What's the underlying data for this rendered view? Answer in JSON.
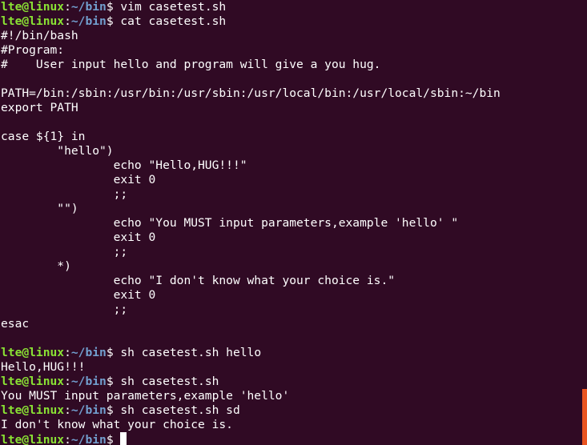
{
  "theme": {
    "background": "#300a24",
    "text": "#ffffff",
    "prompt_user": "#8ae234",
    "prompt_path": "#729fcf",
    "scrollbar_thumb": "#e95420"
  },
  "prompt": {
    "user": "lte@linux",
    "sep": ":",
    "path": "~/bin",
    "symbol": "$ "
  },
  "lines": [
    {
      "type": "prompt",
      "cmd": "vim casetest.sh"
    },
    {
      "type": "prompt",
      "cmd": "cat casetest.sh"
    },
    {
      "type": "output",
      "text": "#!/bin/bash"
    },
    {
      "type": "output",
      "text": "#Program:"
    },
    {
      "type": "output",
      "text": "#    User input hello and program will give a you hug."
    },
    {
      "type": "output",
      "text": ""
    },
    {
      "type": "output",
      "text": "PATH=/bin:/sbin:/usr/bin:/usr/sbin:/usr/local/bin:/usr/local/sbin:~/bin"
    },
    {
      "type": "output",
      "text": "export PATH"
    },
    {
      "type": "output",
      "text": ""
    },
    {
      "type": "output",
      "text": "case ${1} in"
    },
    {
      "type": "output",
      "text": "        \"hello\")"
    },
    {
      "type": "output",
      "text": "                echo \"Hello,HUG!!!\""
    },
    {
      "type": "output",
      "text": "                exit 0"
    },
    {
      "type": "output",
      "text": "                ;;"
    },
    {
      "type": "output",
      "text": "        \"\")"
    },
    {
      "type": "output",
      "text": "                echo \"You MUST input parameters,example 'hello' \""
    },
    {
      "type": "output",
      "text": "                exit 0"
    },
    {
      "type": "output",
      "text": "                ;;"
    },
    {
      "type": "output",
      "text": "        *)"
    },
    {
      "type": "output",
      "text": "                echo \"I don't know what your choice is.\""
    },
    {
      "type": "output",
      "text": "                exit 0"
    },
    {
      "type": "output",
      "text": "                ;;"
    },
    {
      "type": "output",
      "text": "esac"
    },
    {
      "type": "output",
      "text": ""
    },
    {
      "type": "prompt",
      "cmd": "sh casetest.sh hello"
    },
    {
      "type": "output",
      "text": "Hello,HUG!!!"
    },
    {
      "type": "prompt",
      "cmd": "sh casetest.sh"
    },
    {
      "type": "output",
      "text": "You MUST input parameters,example 'hello'"
    },
    {
      "type": "prompt",
      "cmd": "sh casetest.sh sd"
    },
    {
      "type": "output",
      "text": "I don't know what your choice is."
    },
    {
      "type": "prompt",
      "cmd": "",
      "cursor": true
    }
  ]
}
